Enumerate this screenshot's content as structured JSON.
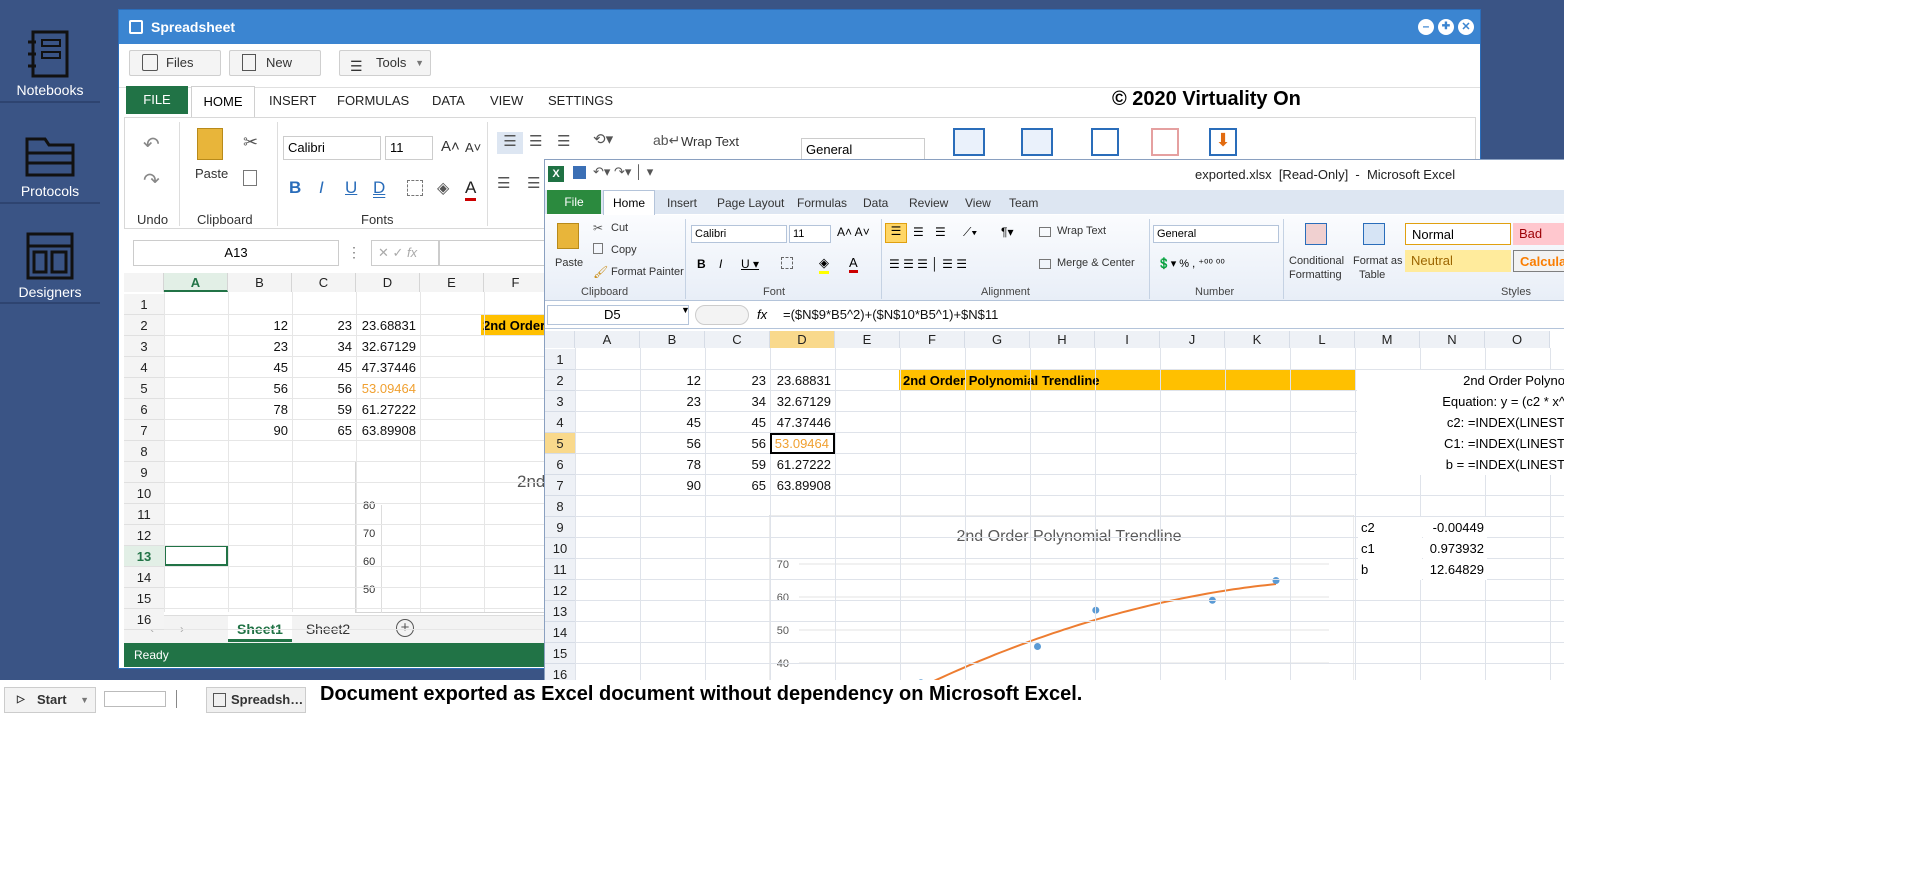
{
  "sidebar": {
    "items": [
      {
        "label": "Notebooks",
        "icon": "notebook-icon"
      },
      {
        "label": "Protocols",
        "icon": "folder-icon"
      },
      {
        "label": "Designers",
        "icon": "layout-icon"
      }
    ]
  },
  "app": {
    "title": "Spreadsheet",
    "toolbar": {
      "files": "Files",
      "new": "New",
      "tools": "Tools"
    },
    "tabs": [
      "FILE",
      "HOME",
      "INSERT",
      "FORMULAS",
      "DATA",
      "VIEW",
      "SETTINGS"
    ],
    "copyright": "© 2020 Virtuality On",
    "ribbon": {
      "undo_group": "Undo",
      "clipboard_group": "Clipboard",
      "paste": "Paste",
      "fonts_group": "Fonts",
      "font_name": "Calibri",
      "font_size": "11",
      "wrap_text": "Wrap Text",
      "number_format": "General"
    },
    "name_box": "A13",
    "formula_icon": "fx",
    "columns": [
      "A",
      "B",
      "C",
      "D",
      "E",
      "F"
    ],
    "rows": [
      "1",
      "2",
      "3",
      "4",
      "5",
      "6",
      "7",
      "8",
      "9",
      "10",
      "11",
      "12",
      "13",
      "14",
      "15",
      "16"
    ],
    "data": [
      [
        "12",
        "23",
        "23.68831"
      ],
      [
        "23",
        "34",
        "32.67129"
      ],
      [
        "45",
        "45",
        "47.37446"
      ],
      [
        "56",
        "56",
        "53.09464"
      ],
      [
        "78",
        "59",
        "61.27222"
      ],
      [
        "90",
        "65",
        "63.89908"
      ]
    ],
    "f2_label": "2nd Order",
    "chart_title_partial": "2nd",
    "chart_axis": [
      "80",
      "70",
      "60",
      "50"
    ],
    "sheets": [
      "Sheet1",
      "Sheet2"
    ],
    "status": "Ready"
  },
  "excel": {
    "title": "exported.xlsx  [Read-Only]  -  Microsoft Excel",
    "tabs": [
      "File",
      "Home",
      "Insert",
      "Page Layout",
      "Formulas",
      "Data",
      "Review",
      "View",
      "Team"
    ],
    "ribbon": {
      "paste": "Paste",
      "cut": "Cut",
      "copy": "Copy",
      "format_painter": "Format Painter",
      "clipboard": "Clipboard",
      "font": "Font",
      "font_name": "Calibri",
      "font_size": "11",
      "alignment": "Alignment",
      "wrap_text": "Wrap Text",
      "merge_center": "Merge & Center",
      "number": "Number",
      "number_format": "General",
      "conditional": "Conditional",
      "formatting": "Formatting",
      "format_as": "Format as",
      "table": "Table",
      "styles": "Styles",
      "normal": "Normal",
      "bad": "Bad",
      "neutral": "Neutral",
      "calculation": "Calculat"
    },
    "name_box": "D5",
    "formula": "=($N$9*B5^2)+($N$10*B5^1)+$N$11",
    "columns": [
      "A",
      "B",
      "C",
      "D",
      "E",
      "F",
      "G",
      "H",
      "I",
      "J",
      "K",
      "L",
      "M",
      "N",
      "O"
    ],
    "rows": [
      "1",
      "2",
      "3",
      "4",
      "5",
      "6",
      "7",
      "8",
      "9",
      "10",
      "11",
      "12",
      "13",
      "14",
      "15",
      "16"
    ],
    "header_label": "2nd Order Polynomial Trendline",
    "notes": [
      "2nd Order Polyno",
      "Equation: y = (c2 * x^",
      "c2: =INDEX(LINEST",
      "C1: =INDEX(LINEST",
      "b = =INDEX(LINEST"
    ],
    "coeffs": [
      {
        "name": "c2",
        "value": "-0.00449"
      },
      {
        "name": "c1",
        "value": "0.973932"
      },
      {
        "name": "b",
        "value": "12.64829"
      }
    ]
  },
  "chart_data": {
    "type": "scatter",
    "title": "2nd Order Polynomial Trendline",
    "y_ticks": [
      "70",
      "60",
      "50",
      "40"
    ],
    "visible_points": [
      [
        23,
        34
      ],
      [
        45,
        45
      ],
      [
        56,
        56
      ],
      [
        78,
        59
      ],
      [
        90,
        65
      ]
    ],
    "series": [
      {
        "values": [
          [
            12,
            23
          ],
          [
            23,
            34
          ],
          [
            45,
            45
          ],
          [
            56,
            56
          ],
          [
            78,
            59
          ],
          [
            90,
            65
          ]
        ]
      }
    ],
    "trendline": "polynomial-2",
    "colors": {
      "points": "#5b9bd5",
      "trendline": "#ed7d31"
    }
  },
  "taskbar": {
    "start": "Start",
    "task": "Spreadsh…",
    "caption": "Document exported as Excel document without dependency on Microsoft Excel."
  }
}
